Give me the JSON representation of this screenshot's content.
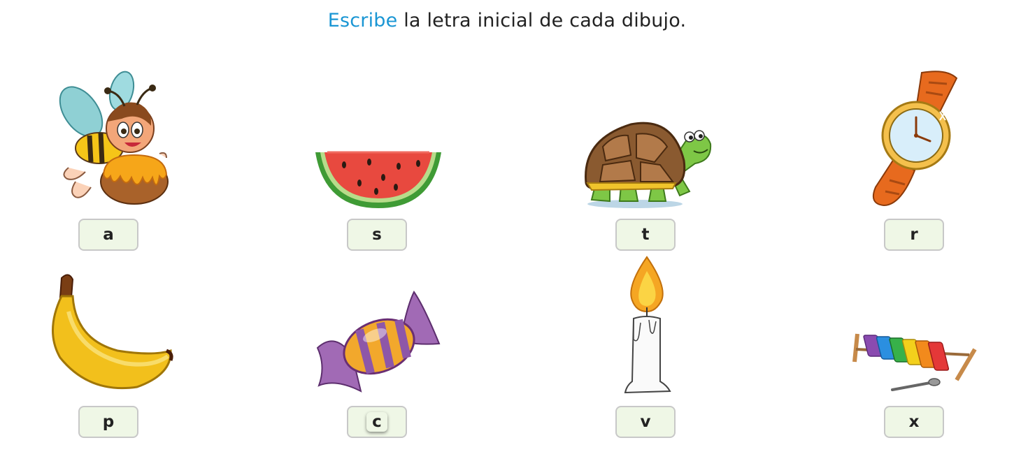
{
  "instruction": {
    "accent": "Escribe",
    "rest": " la letra inicial de cada dibujo."
  },
  "items": [
    {
      "picture": "bee-honey-icon",
      "letter": "a"
    },
    {
      "picture": "watermelon-icon",
      "letter": "s"
    },
    {
      "picture": "turtle-icon",
      "letter": "t"
    },
    {
      "picture": "watch-icon",
      "letter": "r"
    },
    {
      "picture": "banana-icon",
      "letter": "p"
    },
    {
      "picture": "candy-icon",
      "letter": "c"
    },
    {
      "picture": "candle-icon",
      "letter": "v"
    },
    {
      "picture": "xylophone-icon",
      "letter": "x"
    }
  ]
}
